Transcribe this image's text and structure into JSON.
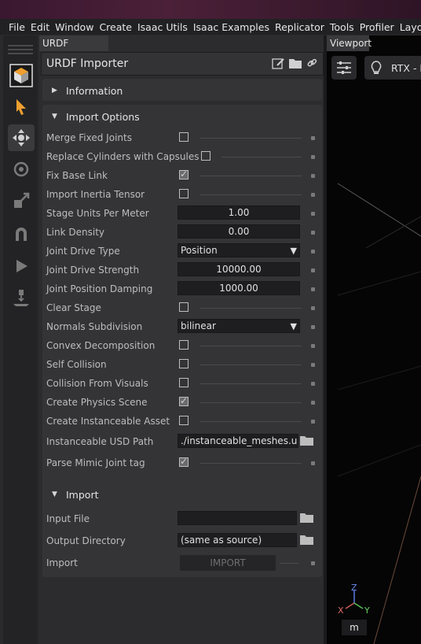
{
  "menu": [
    "File",
    "Edit",
    "Window",
    "Create",
    "Isaac Utils",
    "Isaac Examples",
    "Replicator",
    "Tools",
    "Profiler",
    "Layout"
  ],
  "urdf_window": {
    "tab_label": "URDF Importer",
    "title": "URDF Importer",
    "sections": {
      "information": "Information",
      "import_options": "Import Options",
      "import": "Import"
    },
    "options": {
      "merge_fixed_joints": {
        "label": "Merge Fixed Joints",
        "checked": false
      },
      "replace_cylinders": {
        "label": "Replace Cylinders with Capsules",
        "checked": false
      },
      "fix_base_link": {
        "label": "Fix Base Link",
        "checked": true
      },
      "import_inertia": {
        "label": "Import Inertia Tensor",
        "checked": false
      },
      "stage_units": {
        "label": "Stage Units Per Meter",
        "value": "1.00"
      },
      "link_density": {
        "label": "Link Density",
        "value": "0.00"
      },
      "joint_drive_type": {
        "label": "Joint Drive Type",
        "value": "Position"
      },
      "joint_drive_strength": {
        "label": "Joint Drive Strength",
        "value": "10000.00"
      },
      "joint_position_damping": {
        "label": "Joint Position Damping",
        "value": "1000.00"
      },
      "clear_stage": {
        "label": "Clear Stage",
        "checked": false
      },
      "normals_subdivision": {
        "label": "Normals Subdivision",
        "value": "bilinear"
      },
      "convex_decomposition": {
        "label": "Convex Decomposition",
        "checked": false
      },
      "self_collision": {
        "label": "Self Collision",
        "checked": false
      },
      "collision_from_visuals": {
        "label": "Collision From Visuals",
        "checked": false
      },
      "create_physics_scene": {
        "label": "Create Physics Scene",
        "checked": true
      },
      "create_instanceable_asset": {
        "label": "Create Instanceable Asset",
        "checked": false
      },
      "instanceable_usd_path": {
        "label": "Instanceable USD Path",
        "value": "./instanceable_meshes.us"
      },
      "parse_mimic": {
        "label": "Parse Mimic Joint tag",
        "checked": true
      }
    },
    "import": {
      "input_file_label": "Input File",
      "input_file_value": "",
      "output_dir_label": "Output Directory",
      "output_dir_value": "(same as source)",
      "import_label": "Import",
      "import_button": "IMPORT"
    }
  },
  "viewport": {
    "tab_label": "Viewport",
    "renderer": "RTX - R",
    "unit": "m",
    "axis_x": "X",
    "axis_y": "Y",
    "axis_z": "Z"
  },
  "colors": {
    "accent_orange": "#f0a030",
    "menubar": "#212123",
    "panel": "#343437"
  },
  "toolbar_icons": [
    "isaac-logo-icon",
    "select-arrow-icon",
    "move-icon",
    "rotate-icon",
    "scale-icon",
    "snap-magnet-icon",
    "play-icon",
    "drop-to-ground-icon"
  ]
}
